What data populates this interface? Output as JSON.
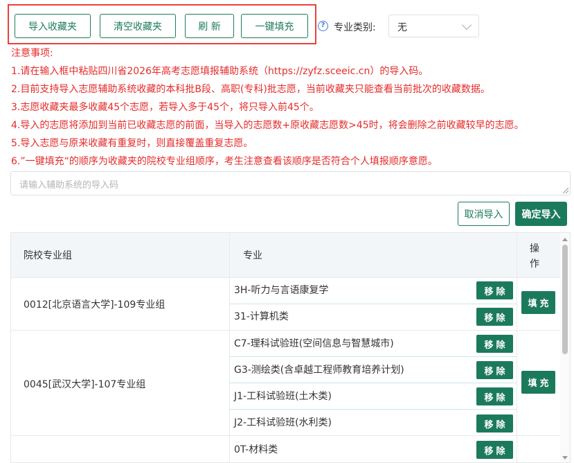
{
  "toolbar": {
    "import_label": "导入收藏夹",
    "clear_label": "清空收藏夹",
    "refresh_label": "刷 新",
    "fill_label": "一键填充"
  },
  "filter": {
    "help_icon": "?",
    "label": "专业类别:",
    "value": "无"
  },
  "notice": {
    "title": "注意事项:",
    "items": [
      "1.请在输入框中粘贴四川省2026年高考志愿填报辅助系统（https://zyfz.sceeic.cn）的导入码。",
      "2.目前支持导入志愿辅助系统收藏的本科批B段、高职(专科)批志愿，当前收藏夹只能查看当前批次的收藏数据。",
      "3.志愿收藏夹最多收藏45个志愿，若导入多于45个，将只导入前45个。",
      "4.导入的志愿将添加到当前已收藏志愿的前面，当导入的志愿数+原收藏志愿数>45时，将会删除之前收藏较早的志愿。",
      "5.导入志愿与原来收藏有重复时，则直接覆盖重复志愿。",
      "6.”一键填充“的顺序为收藏夹的院校专业组顺序，考生注意查看该顺序是否符合个人填报顺序意愿。"
    ]
  },
  "import_input": {
    "placeholder": "请输入辅助系统的导入码",
    "value": ""
  },
  "actions": {
    "cancel_label": "取消导入",
    "confirm_label": "确定导入"
  },
  "table": {
    "headers": {
      "group": "院校专业组",
      "major": "专业",
      "operation": "操作"
    },
    "remove_label": "移除",
    "fill_label": "填充",
    "groups": [
      {
        "name": "0012[北京语言大学]-109专业组",
        "majors": [
          "3H-听力与言语康复学",
          "31-计算机类"
        ]
      },
      {
        "name": "0045[武汉大学]-107专业组",
        "majors": [
          "C7-理科试验班(空间信息与智慧城市)",
          "G3-测绘类(含卓越工程师教育培养计划)",
          "J1-工科试验班(土木类)",
          "J2-工科试验班(水利类)",
          "0T-材料类"
        ]
      }
    ]
  }
}
